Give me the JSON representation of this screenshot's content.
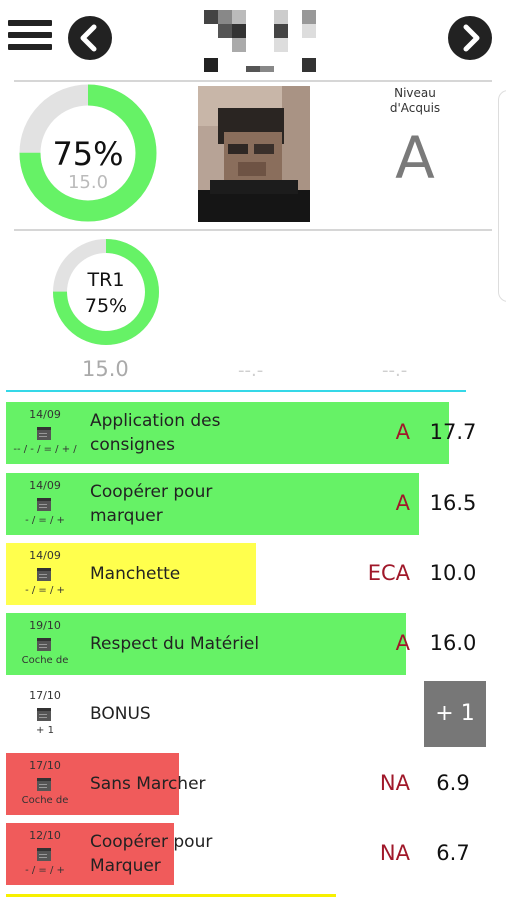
{
  "colors": {
    "green": "#66f266",
    "yellow": "#ffff4d",
    "red": "#f05b5b",
    "gray": "#e2e2e2",
    "cyan": "#35d8e8",
    "grade_red": "#a0182a"
  },
  "header": {
    "menu_icon": "hamburger-icon",
    "prev_icon": "chevron-left-icon",
    "next_icon": "chevron-right-icon"
  },
  "summary": {
    "main_percent_value": 0.75,
    "main_percent": "75%",
    "main_score": "15.0",
    "level_label_line1": "Niveau",
    "level_label_line2": "d'Acquis",
    "level_letter": "A",
    "tr_label": "TR1",
    "tr_percent": "75%",
    "tr_percent_value": 0.75,
    "scores": [
      "15.0",
      "--.-",
      "--.-"
    ]
  },
  "rows": [
    {
      "date": "14/09",
      "marks": "-- / - / = / + /",
      "title_l1": "Application des",
      "title_l2": "consignes",
      "grade": "A",
      "score": "17.7",
      "bar_color": "#66f266",
      "bar_fraction": 0.885
    },
    {
      "date": "14/09",
      "marks": "- / = / +",
      "title_l1": "Coopérer pour",
      "title_l2": "marquer",
      "grade": "A",
      "score": "16.5",
      "bar_color": "#66f266",
      "bar_fraction": 0.825
    },
    {
      "date": "14/09",
      "marks": "- / = / +",
      "title_l1": "Manchette",
      "title_l2": "",
      "grade": "ECA",
      "score": "10.0",
      "bar_color": "#ffff4d",
      "bar_fraction": 0.5
    },
    {
      "date": "19/10",
      "marks": "Coche de",
      "title_l1": "Respect du Matériel",
      "title_l2": "",
      "grade": "A",
      "score": "16.0",
      "bar_color": "#66f266",
      "bar_fraction": 0.8
    },
    {
      "date": "17/10",
      "marks": "+ 1",
      "title_l1": "BONUS",
      "title_l2": "",
      "grade": "",
      "score": "",
      "bonus": "+ 1",
      "bar_color": "",
      "bar_fraction": 0
    },
    {
      "date": "17/10",
      "marks": "Coche de",
      "title_l1": "Sans Marcher",
      "title_l2": "",
      "grade": "NA",
      "score": "6.9",
      "bar_color": "#f05b5b",
      "bar_fraction": 0.345
    },
    {
      "date": "12/10",
      "marks": "- / = / +",
      "title_l1": "Coopérer pour",
      "title_l2": "Marquer",
      "grade": "NA",
      "score": "6.7",
      "bar_color": "#f05b5b",
      "bar_fraction": 0.335
    }
  ]
}
